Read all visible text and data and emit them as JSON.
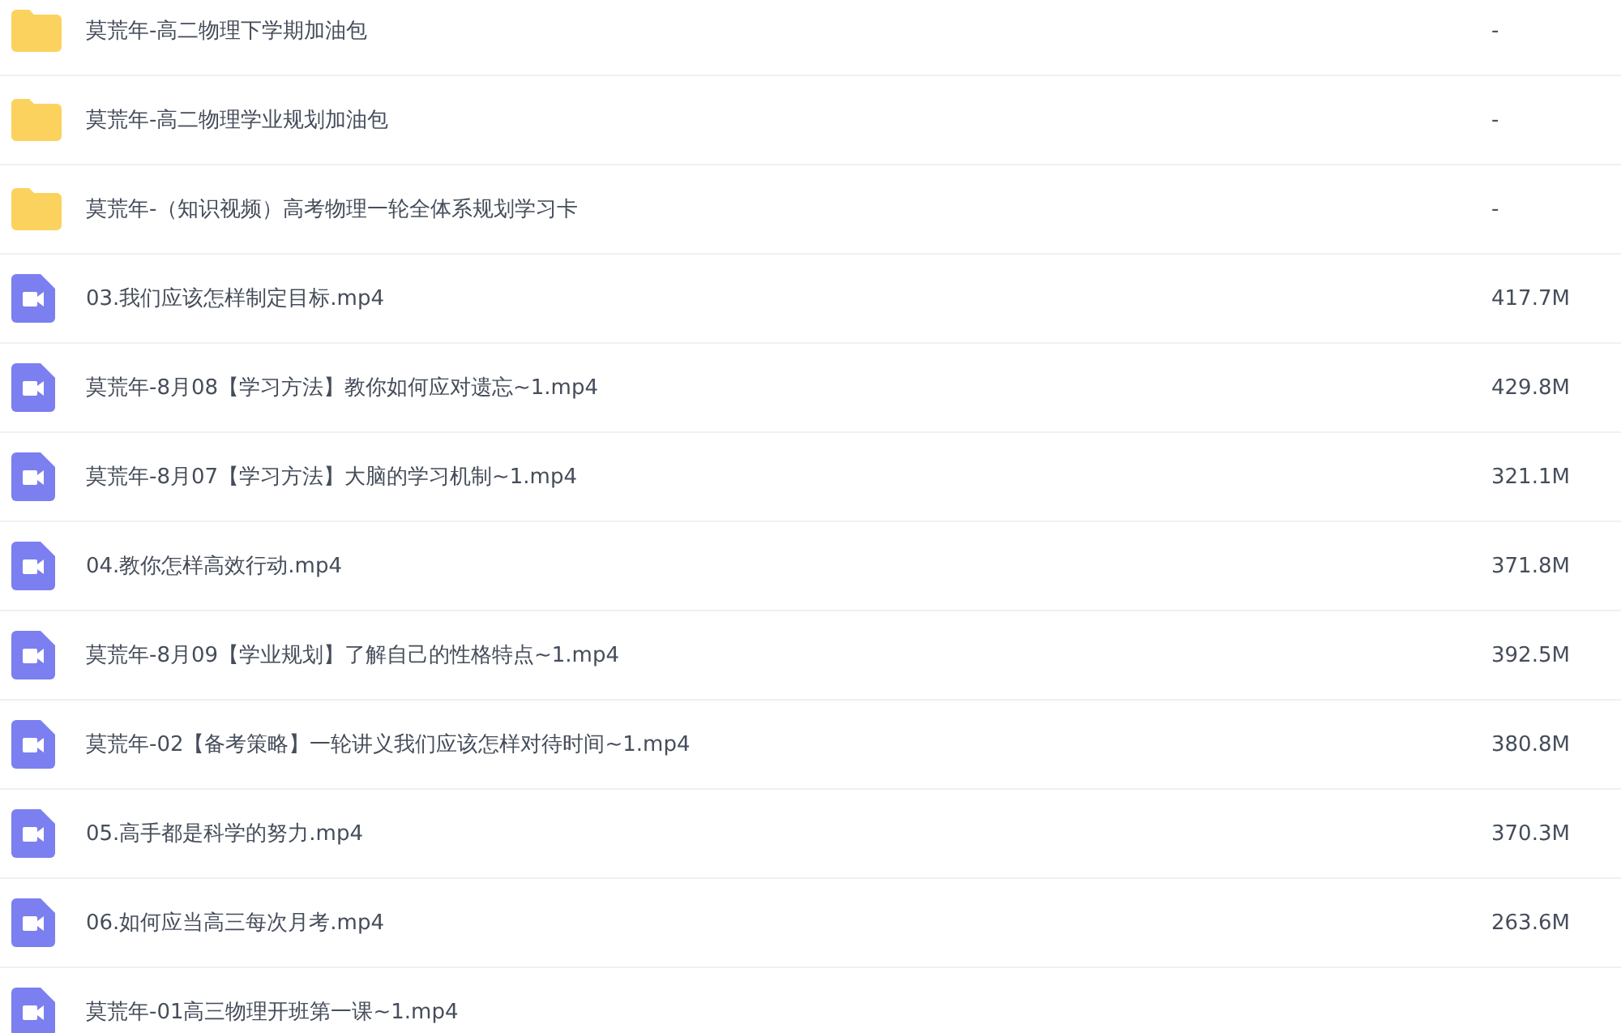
{
  "files": [
    {
      "kind": "folder",
      "name": "莫荒年-高二物理下学期加油包",
      "size": "-"
    },
    {
      "kind": "folder",
      "name": "莫荒年-高二物理学业规划加油包",
      "size": "-"
    },
    {
      "kind": "folder",
      "name": "莫荒年-（知识视频）高考物理一轮全体系规划学习卡",
      "size": "-"
    },
    {
      "kind": "video",
      "name": "03.我们应该怎样制定目标.mp4",
      "size": "417.7M"
    },
    {
      "kind": "video",
      "name": "莫荒年-8月08【学习方法】教你如何应对遗忘~1.mp4",
      "size": "429.8M"
    },
    {
      "kind": "video",
      "name": "莫荒年-8月07【学习方法】大脑的学习机制~1.mp4",
      "size": "321.1M"
    },
    {
      "kind": "video",
      "name": "04.教你怎样高效行动.mp4",
      "size": "371.8M"
    },
    {
      "kind": "video",
      "name": "莫荒年-8月09【学业规划】了解自己的性格特点~1.mp4",
      "size": "392.5M"
    },
    {
      "kind": "video",
      "name": "莫荒年-02【备考策略】一轮讲义我们应该怎样对待时间~1.mp4",
      "size": "380.8M"
    },
    {
      "kind": "video",
      "name": "05.高手都是科学的努力.mp4",
      "size": "370.3M"
    },
    {
      "kind": "video",
      "name": "06.如何应当高三每次月考.mp4",
      "size": "263.6M"
    },
    {
      "kind": "video",
      "name": "莫荒年-01高三物理开班第一课~1.mp4"
    }
  ]
}
